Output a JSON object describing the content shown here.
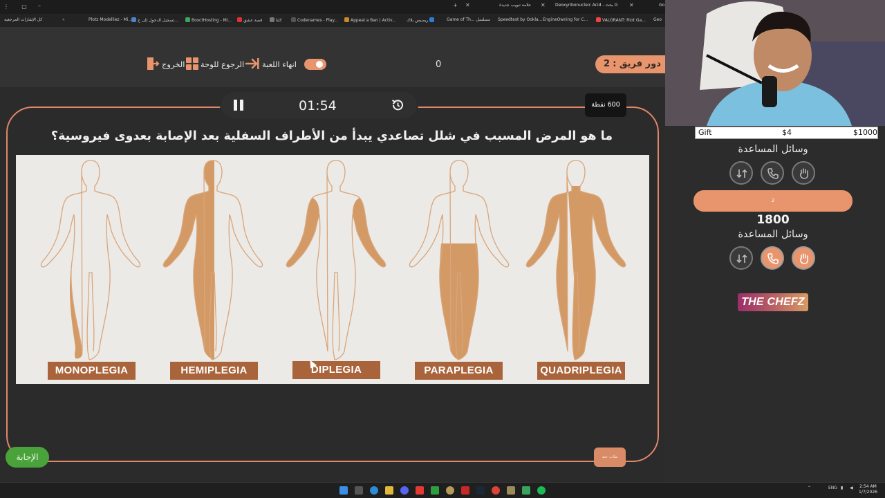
{
  "browser": {
    "tabs": [
      {
        "label": "علامة تبويب جديدة"
      },
      {
        "label": "Deoxyribonucleic Acid - بحث G"
      }
    ],
    "partial_tab": "Go",
    "bookmarks": [
      {
        "label": "كل الإشارات المرجعية",
        "color": "#9a9a9a"
      },
      {
        "label": "Plotz Modelliez - Mi...",
        "color": "#6b8f3a"
      },
      {
        "label": "تسجيل الدخول إلى ح...",
        "color": "#4a86c8"
      },
      {
        "label": "BoxctHosting - Mi...",
        "color": "#3da55d"
      },
      {
        "label": "قصة عشق",
        "color": "#d33"
      },
      {
        "label": "كلنا",
        "color": "#777"
      },
      {
        "label": "Codenames - Play...",
        "color": "#444"
      },
      {
        "label": "Appeal a Ban | Activ...",
        "color": "#c98a2b"
      },
      {
        "label": "ريمنيس بلاك",
        "color": "#2a7fd4"
      },
      {
        "label": "Game of Th... مسلسل",
        "color": "#555"
      },
      {
        "label": "Speedtest by Ookla...",
        "color": "#333"
      },
      {
        "label": "EngineOwning for C...",
        "color": "#666"
      },
      {
        "label": "VALORANT: Riot Ga...",
        "color": "#e44"
      },
      {
        "label": "Geo",
        "color": "#888"
      }
    ]
  },
  "header": {
    "team_turn_label": "دور فريق :",
    "team_turn_value": "2",
    "score": "0",
    "end_game_label": "انهاء اللعبة",
    "back_to_board_label": "الرجوع للوحة",
    "exit_label": "الخروج"
  },
  "question": {
    "timer": "01:54",
    "points": "600 نقطة",
    "text": "ما هو المرض المسبب في شلل تصاعدي يبدأ من الأطراف السفلية بعد الإصابة بعدوى فيروسية؟",
    "image_labels": [
      "MONOPLEGIA",
      "HEMIPLEGIA",
      "DIPLEGIA",
      "PARAPLEGIA",
      "QUADRIPLEGIA"
    ],
    "answer_label": "الإجابة",
    "small_button_label": "طاب عنه"
  },
  "panel": {
    "gift_label": "Gift",
    "gift_amount": "$4",
    "gift_goal": "$1000",
    "team1_lifelines_title": "وسائل المساعدة",
    "team2_label": "2",
    "team2_score": "1800",
    "team2_lifelines_title": "وسائل المساعدة",
    "logo_text": "THE CHEFZ"
  },
  "taskbar": {
    "lang": "ENG",
    "time": "2:54 AM",
    "date": "1/7/2026"
  },
  "colors": {
    "accent": "#e8956e",
    "frame": "#e0876a",
    "label_brown": "#a9643b",
    "answer_green": "#4aa33a"
  }
}
